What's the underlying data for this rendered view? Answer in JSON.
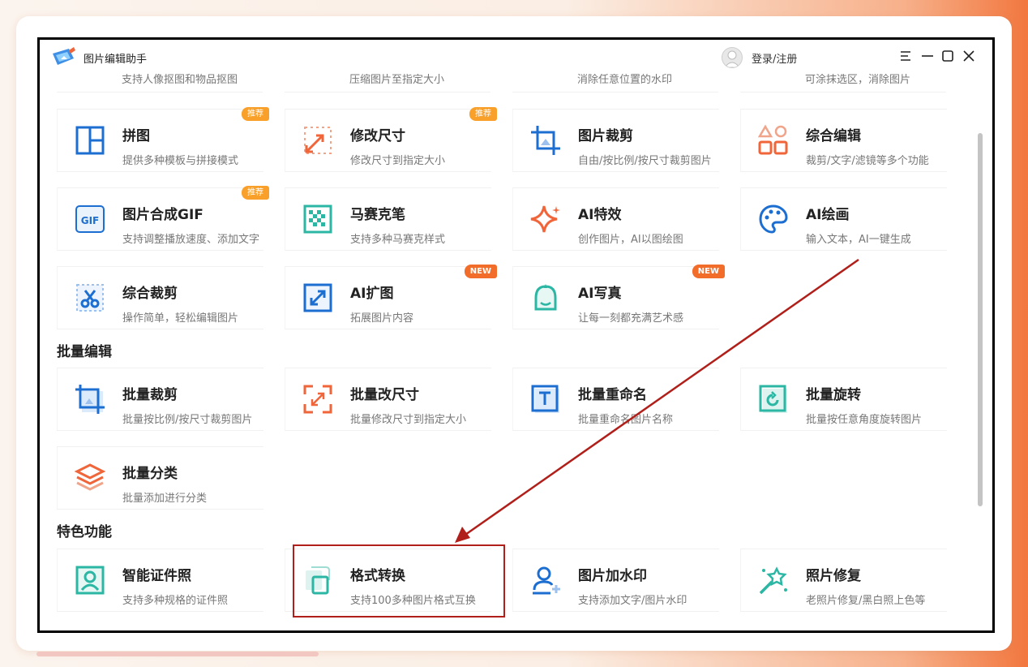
{
  "app": {
    "title": "图片编辑助手"
  },
  "header": {
    "login_label": "登录/注册"
  },
  "partial_row": [
    {
      "desc": "支持人像抠图和物品抠图"
    },
    {
      "desc": "压缩图片至指定大小"
    },
    {
      "desc": "消除任意位置的水印"
    },
    {
      "desc": "可涂抹选区，消除图片"
    }
  ],
  "cards": [
    {
      "title": "拼图",
      "desc": "提供多种模板与拼接模式",
      "badge": "推荐",
      "icon": "collage-icon"
    },
    {
      "title": "修改尺寸",
      "desc": "修改尺寸到指定大小",
      "badge": "推荐",
      "icon": "resize-icon"
    },
    {
      "title": "图片裁剪",
      "desc": "自由/按比例/按尺寸裁剪图片",
      "icon": "crop-icon"
    },
    {
      "title": "综合编辑",
      "desc": "裁剪/文字/滤镜等多个功能",
      "icon": "shapes-icon"
    },
    {
      "title": "图片合成GIF",
      "desc": "支持调整播放速度、添加文字",
      "badge": "推荐",
      "icon": "gif-icon"
    },
    {
      "title": "马赛克笔",
      "desc": "支持多种马赛克样式",
      "icon": "mosaic-icon"
    },
    {
      "title": "AI特效",
      "desc": "创作图片，AI以图绘图",
      "icon": "sparkle-icon"
    },
    {
      "title": "AI绘画",
      "desc": "输入文本，AI一键生成",
      "icon": "palette-icon"
    },
    {
      "title": "综合裁剪",
      "desc": "操作简单，轻松编辑图片",
      "icon": "scissors-icon"
    },
    {
      "title": "AI扩图",
      "desc": "拓展图片内容",
      "badge": "NEW",
      "icon": "expand-icon"
    },
    {
      "title": "AI写真",
      "desc": "让每一刻都充满艺术感",
      "badge": "NEW",
      "icon": "portrait-icon"
    }
  ],
  "batch": {
    "heading": "批量编辑",
    "cards": [
      {
        "title": "批量裁剪",
        "desc": "批量按比例/按尺寸裁剪图片",
        "icon": "batch-crop-icon"
      },
      {
        "title": "批量改尺寸",
        "desc": "批量修改尺寸到指定大小",
        "icon": "batch-resize-icon"
      },
      {
        "title": "批量重命名",
        "desc": "批量重命名图片名称",
        "icon": "rename-icon"
      },
      {
        "title": "批量旋转",
        "desc": "批量按任意角度旋转图片",
        "icon": "rotate-icon"
      },
      {
        "title": "批量分类",
        "desc": "批量添加进行分类",
        "icon": "layers-icon"
      }
    ]
  },
  "features": {
    "heading": "特色功能",
    "cards": [
      {
        "title": "智能证件照",
        "desc": "支持多种规格的证件照",
        "icon": "id-photo-icon"
      },
      {
        "title": "格式转换",
        "desc": "支持100多种图片格式互换",
        "icon": "format-convert-icon"
      },
      {
        "title": "图片加水印",
        "desc": "支持添加文字/图片水印",
        "icon": "watermark-icon"
      },
      {
        "title": "照片修复",
        "desc": "老照片修复/黑白照上色等",
        "icon": "magic-wand-icon"
      }
    ]
  },
  "colors": {
    "blue": "#1d6ed1",
    "orange": "#f0663a",
    "teal": "#2bb7a4",
    "annotation_red": "#b01f1a"
  }
}
